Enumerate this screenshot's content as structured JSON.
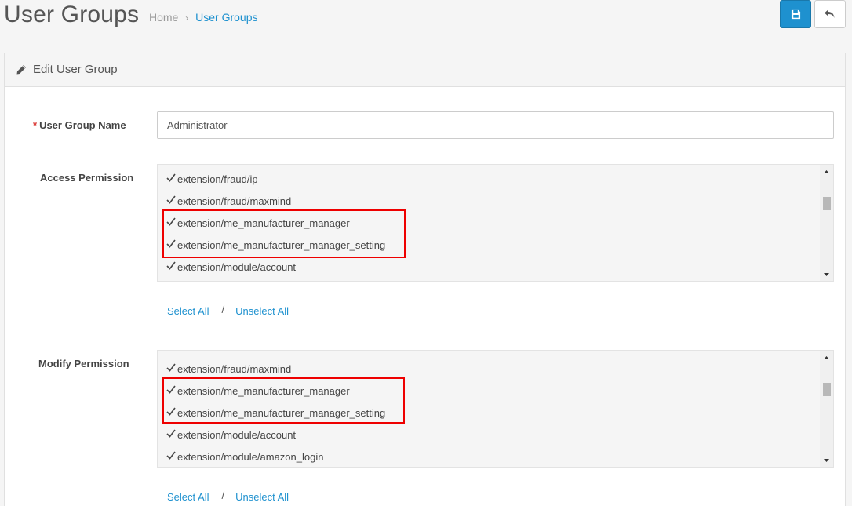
{
  "header": {
    "title": "User Groups",
    "breadcrumb": {
      "home": "Home",
      "separator": "›",
      "current": "User Groups"
    },
    "save_icon": "save-icon",
    "back_icon": "reply-icon"
  },
  "panel": {
    "heading": "Edit User Group",
    "heading_icon": "pencil-icon"
  },
  "form": {
    "name_label": "User Group Name",
    "required_mark": "*",
    "name_value": "Administrator",
    "access": {
      "label": "Access Permission",
      "items": [
        "extension/fraud/ip",
        "extension/fraud/maxmind",
        "extension/me_manufacturer_manager",
        "extension/me_manufacturer_manager_setting",
        "extension/module/account"
      ],
      "select_all": "Select All",
      "separator": "/",
      "unselect_all": "Unselect All"
    },
    "modify": {
      "label": "Modify Permission",
      "items": [
        "extension/fraud/maxmind",
        "extension/me_manufacturer_manager",
        "extension/me_manufacturer_manager_setting",
        "extension/module/account",
        "extension/module/amazon_login"
      ],
      "select_all": "Select All",
      "separator": "/",
      "unselect_all": "Unselect All"
    }
  },
  "colors": {
    "primary": "#1e91cf",
    "highlight": "#ee0000",
    "required": "#d9302c"
  }
}
